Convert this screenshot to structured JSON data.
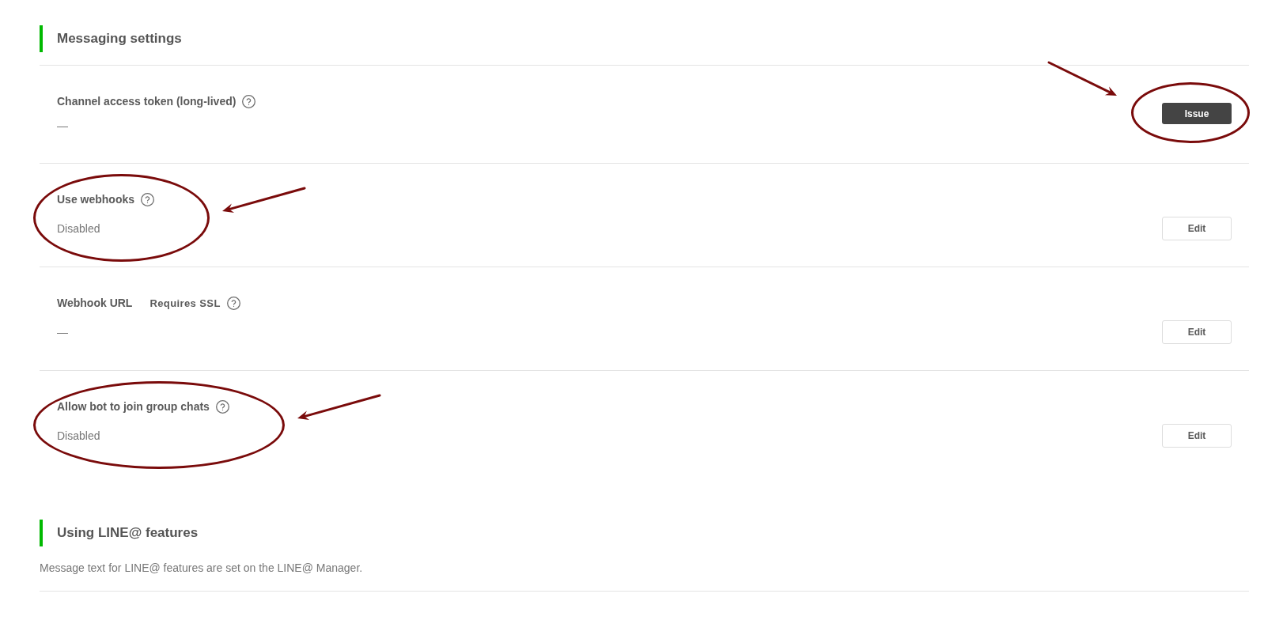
{
  "sections": [
    {
      "title": "Messaging settings",
      "rows": [
        {
          "label": "Channel access token (long-lived)",
          "help": true,
          "value": "—",
          "circled": false,
          "action": {
            "kind": "primary",
            "label": "Issue",
            "circled": true
          }
        },
        {
          "label": "Use webhooks",
          "help": true,
          "value": "Disabled",
          "circled": true,
          "action": {
            "kind": "secondary",
            "label": "Edit",
            "circled": false
          }
        },
        {
          "label": "Webhook URL",
          "note": "Requires SSL",
          "help": true,
          "value": "—",
          "circled": false,
          "action": {
            "kind": "secondary",
            "label": "Edit",
            "circled": false
          }
        },
        {
          "label": "Allow bot to join group chats",
          "help": true,
          "value": "Disabled",
          "circled": true,
          "action": {
            "kind": "secondary",
            "label": "Edit",
            "circled": false
          }
        }
      ]
    },
    {
      "title": "Using LINE@ features",
      "description": "Message text for LINE@ features are set on the LINE@ Manager."
    }
  ]
}
